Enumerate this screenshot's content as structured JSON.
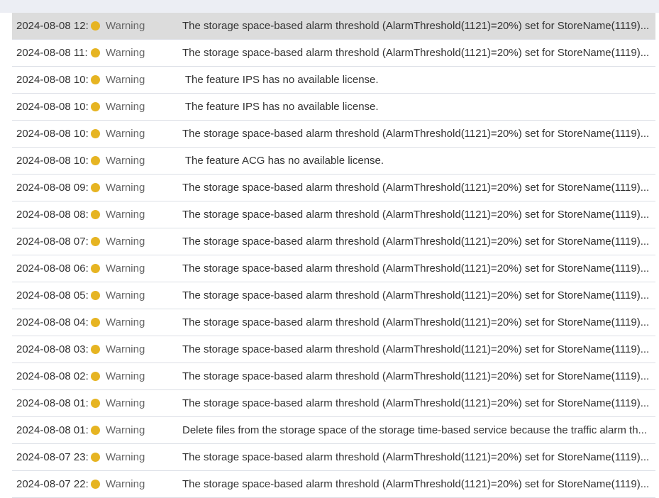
{
  "colors": {
    "warning_dot": "#e6b422",
    "selected_row": "#dcdcdc",
    "row_border": "#dcdfe6"
  },
  "log": {
    "rows": [
      {
        "time": "2024-08-08 12:",
        "level": "Warning",
        "message": "The storage space-based alarm threshold (AlarmThreshold(1121)=20%) set for StoreName(1119)...",
        "selected": true
      },
      {
        "time": "2024-08-08 11:",
        "level": "Warning",
        "message": "The storage space-based alarm threshold (AlarmThreshold(1121)=20%) set for StoreName(1119)..."
      },
      {
        "time": "2024-08-08 10:",
        "level": "Warning",
        "message": " The feature IPS has no available license."
      },
      {
        "time": "2024-08-08 10:",
        "level": "Warning",
        "message": " The feature IPS has no available license."
      },
      {
        "time": "2024-08-08 10:",
        "level": "Warning",
        "message": "The storage space-based alarm threshold (AlarmThreshold(1121)=20%) set for StoreName(1119)..."
      },
      {
        "time": "2024-08-08 10:",
        "level": "Warning",
        "message": " The feature ACG has no available license."
      },
      {
        "time": "2024-08-08 09:",
        "level": "Warning",
        "message": "The storage space-based alarm threshold (AlarmThreshold(1121)=20%) set for StoreName(1119)..."
      },
      {
        "time": "2024-08-08 08:",
        "level": "Warning",
        "message": "The storage space-based alarm threshold (AlarmThreshold(1121)=20%) set for StoreName(1119)..."
      },
      {
        "time": "2024-08-08 07:",
        "level": "Warning",
        "message": "The storage space-based alarm threshold (AlarmThreshold(1121)=20%) set for StoreName(1119)..."
      },
      {
        "time": "2024-08-08 06:",
        "level": "Warning",
        "message": "The storage space-based alarm threshold (AlarmThreshold(1121)=20%) set for StoreName(1119)..."
      },
      {
        "time": "2024-08-08 05:",
        "level": "Warning",
        "message": "The storage space-based alarm threshold (AlarmThreshold(1121)=20%) set for StoreName(1119)..."
      },
      {
        "time": "2024-08-08 04:",
        "level": "Warning",
        "message": "The storage space-based alarm threshold (AlarmThreshold(1121)=20%) set for StoreName(1119)..."
      },
      {
        "time": "2024-08-08 03:",
        "level": "Warning",
        "message": "The storage space-based alarm threshold (AlarmThreshold(1121)=20%) set for StoreName(1119)..."
      },
      {
        "time": "2024-08-08 02:",
        "level": "Warning",
        "message": "The storage space-based alarm threshold (AlarmThreshold(1121)=20%) set for StoreName(1119)..."
      },
      {
        "time": "2024-08-08 01:",
        "level": "Warning",
        "message": "The storage space-based alarm threshold (AlarmThreshold(1121)=20%) set for StoreName(1119)..."
      },
      {
        "time": "2024-08-08 01:",
        "level": "Warning",
        "message": "Delete files from the storage space of the storage time-based service because the traffic alarm th..."
      },
      {
        "time": "2024-08-07 23:",
        "level": "Warning",
        "message": "The storage space-based alarm threshold (AlarmThreshold(1121)=20%) set for StoreName(1119)..."
      },
      {
        "time": "2024-08-07 22:",
        "level": "Warning",
        "message": "The storage space-based alarm threshold (AlarmThreshold(1121)=20%) set for StoreName(1119)..."
      }
    ]
  }
}
